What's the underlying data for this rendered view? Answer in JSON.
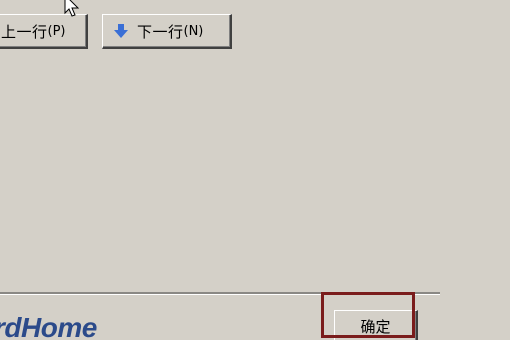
{
  "toolbar": {
    "prev_button": {
      "label": "上一行",
      "accel": "(P)",
      "icon": "arrow-up-icon"
    },
    "next_button": {
      "label": "下一行",
      "accel": "(N)",
      "icon": "arrow-down-icon"
    }
  },
  "footer": {
    "logo_text": "rdHome",
    "ok_button": {
      "label": "确定"
    }
  },
  "colors": {
    "window_bg": "#d4d0c8",
    "arrow_blue": "#3a6fd6",
    "highlight_border": "#7a1c1c",
    "logo_blue": "#2b4a8a"
  }
}
